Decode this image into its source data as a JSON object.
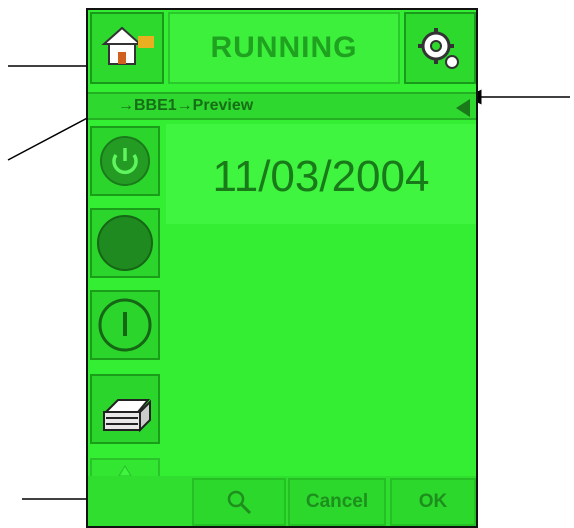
{
  "header": {
    "home_icon": "home-icon",
    "status": "RUNNING",
    "settings_icon": "gear-icon"
  },
  "breadcrumb": {
    "text": "→BBE1→Preview",
    "back_icon": "back-arrow-icon"
  },
  "sidebar": {
    "items": [
      {
        "icon": "power-icon"
      },
      {
        "icon": "stop-circle-icon"
      },
      {
        "icon": "start-icon"
      },
      {
        "icon": "printer-icon"
      },
      {
        "icon": "directional-pad-icon"
      }
    ]
  },
  "main": {
    "date": "11/03/2004"
  },
  "footer": {
    "zoom_icon": "magnifier-icon",
    "cancel_label": "Cancel",
    "ok_label": "OK"
  },
  "colors": {
    "screen": "#33ee33",
    "text": "#1d8f1d",
    "dark": "#166f16"
  }
}
